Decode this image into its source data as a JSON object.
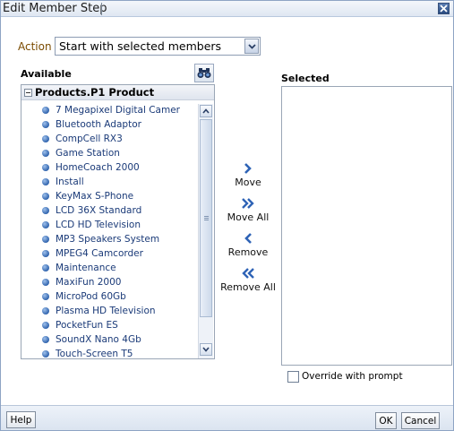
{
  "window": {
    "title": "Edit Member Step"
  },
  "action": {
    "label": "Action",
    "selected": "Start with selected members"
  },
  "available": {
    "label": "Available",
    "tree_title": "Products.P1 Product",
    "items": [
      "7 Megapixel Digital Camer",
      "Bluetooth Adaptor",
      "CompCell RX3",
      "Game Station",
      "HomeCoach 2000",
      "Install",
      "KeyMax S-Phone",
      "LCD 36X Standard",
      "LCD HD Television",
      "MP3 Speakers System",
      "MPEG4 Camcorder",
      "Maintenance",
      "MaxiFun 2000",
      "MicroPod 60Gb",
      "Plasma HD Television",
      "PocketFun ES",
      "SoundX Nano 4Gb",
      "Touch-Screen T5"
    ]
  },
  "movers": {
    "move": "Move",
    "move_all": "Move All",
    "remove": "Remove",
    "remove_all": "Remove All"
  },
  "selected": {
    "label": "Selected"
  },
  "override": {
    "label": "Override with prompt",
    "checked": false
  },
  "footer": {
    "help": "Help",
    "ok": "OK",
    "cancel": "Cancel"
  },
  "colors": {
    "accent": "#2f63ad",
    "action_label": "#7a4b00",
    "item_text": "#1a3a78"
  },
  "icons": [
    "close-icon",
    "chevron-down-icon",
    "binoculars-icon",
    "bullet-icon",
    "chevron-right-icon",
    "double-chevron-right-icon",
    "chevron-left-icon",
    "double-chevron-left-icon",
    "scroll-up-icon",
    "scroll-down-icon"
  ]
}
